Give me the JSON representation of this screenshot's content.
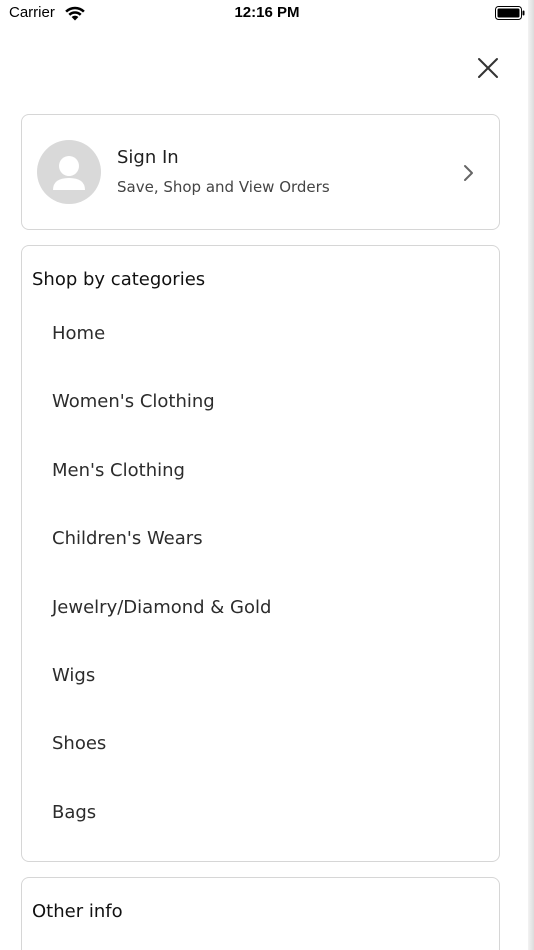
{
  "status_bar": {
    "carrier": "Carrier",
    "time": "12:16 PM"
  },
  "icons": {
    "close": "close-icon",
    "wifi": "wifi-icon",
    "battery": "battery-icon",
    "avatar": "user-avatar-icon",
    "chevron": "chevron-right-icon"
  },
  "signin": {
    "title": "Sign In",
    "subtitle": "Save, Shop and View Orders"
  },
  "categories": {
    "title": "Shop by categories",
    "items": [
      {
        "label": "Home"
      },
      {
        "label": "Women's Clothing"
      },
      {
        "label": "Men's Clothing"
      },
      {
        "label": "Children's Wears"
      },
      {
        "label": "Jewelry/Diamond & Gold"
      },
      {
        "label": "Wigs"
      },
      {
        "label": "Shoes"
      },
      {
        "label": "Bags"
      }
    ]
  },
  "other_info": {
    "title": "Other info"
  },
  "colors": {
    "card_border": "#d6d6d6",
    "avatar_bg": "#d9d9d9",
    "text": "#1f1f1f"
  }
}
